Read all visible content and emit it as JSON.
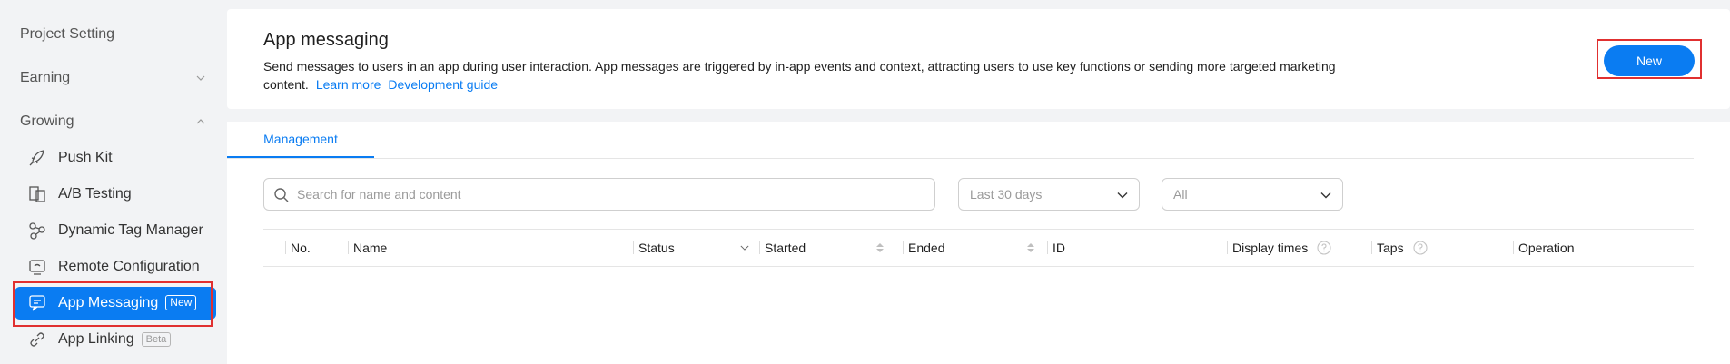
{
  "sidebar": {
    "items": [
      {
        "label": "Project Setting"
      },
      {
        "label": "Earning"
      },
      {
        "label": "Growing"
      }
    ],
    "sub_items": [
      {
        "label": "Push Kit"
      },
      {
        "label": "A/B Testing"
      },
      {
        "label": "Dynamic Tag Manager"
      },
      {
        "label": "Remote Configuration"
      },
      {
        "label": "App Messaging",
        "badge": "New"
      },
      {
        "label": "App Linking",
        "badge": "Beta"
      }
    ]
  },
  "header": {
    "title": "App messaging",
    "description": "Send messages to users in an app during user interaction. App messages are triggered by in-app events and context, attracting users to use key functions or sending more targeted marketing content.",
    "learn_more": "Learn more",
    "dev_guide": "Development guide",
    "new_button": "New"
  },
  "tabs": [
    {
      "label": "Management"
    }
  ],
  "filters": {
    "search_placeholder": "Search for name and content",
    "date_range": "Last 30 days",
    "status": "All"
  },
  "table": {
    "columns": [
      "No.",
      "Name",
      "Status",
      "Started",
      "Ended",
      "ID",
      "Display times",
      "Taps",
      "Operation"
    ]
  },
  "colors": {
    "accent": "#0a7cf2",
    "highlight": "#e03030"
  }
}
